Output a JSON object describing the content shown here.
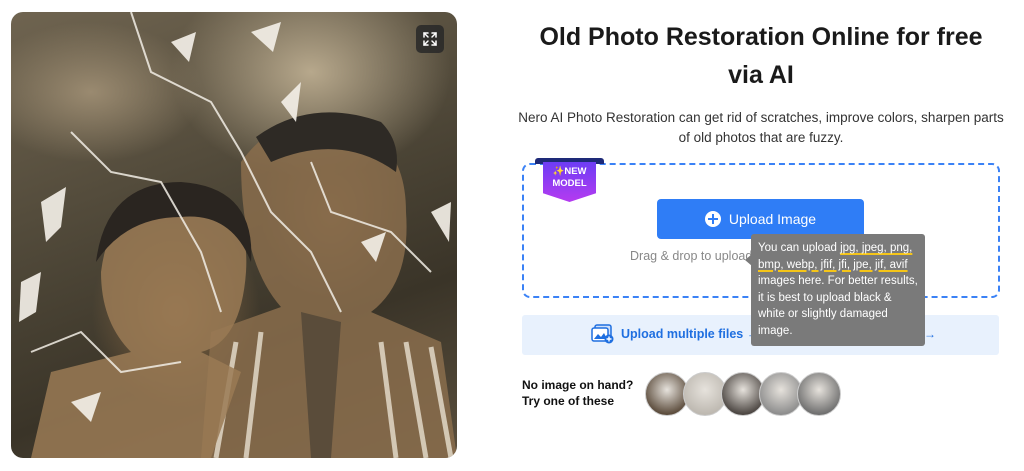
{
  "photo": {
    "alt": "Damaged sepia photo of a man and a woman",
    "expand_icon": "expand-icon"
  },
  "header": {
    "title": "Old Photo Restoration Online for free via AI",
    "description": "Nero AI Photo Restoration can get rid of scratches, improve colors, sharpen parts of old photos that are fuzzy."
  },
  "badge": {
    "line1": "NEW",
    "line2": "MODEL",
    "icon": "sparkle-icon",
    "colors": {
      "top": "#6d3df5",
      "bottom": "#b53bf0",
      "ribbon": "#1e2a78"
    }
  },
  "upload": {
    "button_label": "Upload Image",
    "button_icon": "plus-circle-icon",
    "drag_text": "Drag & drop to upload",
    "accent": "#2f7df6"
  },
  "multi": {
    "label": "Upload multiple files →",
    "trailing_arrow": "→",
    "icon": "multiple-files-icon"
  },
  "tooltip": {
    "lines": [
      {
        "prefix": "You can upload ",
        "underlined": "jpg, jpeg, png,"
      },
      {
        "prefix": "",
        "underlined": "bmp, webp, jfif, jfi, jpe, jif, avif"
      },
      {
        "prefix": "images here. For better results,",
        "underlined": ""
      },
      {
        "prefix": "it is best to upload black &",
        "underlined": ""
      },
      {
        "prefix": "white or slightly damaged",
        "underlined": ""
      },
      {
        "prefix": "image.",
        "underlined": ""
      }
    ]
  },
  "samples": {
    "line1": "No image on hand?",
    "line2": "Try one of these",
    "thumbnails": [
      {
        "name": "sample-1",
        "tone": "#5a4a3a"
      },
      {
        "name": "sample-2",
        "tone": "#bdb8b0"
      },
      {
        "name": "sample-3",
        "tone": "#4a4440"
      },
      {
        "name": "sample-4",
        "tone": "#8c8c8c"
      },
      {
        "name": "sample-5",
        "tone": "#6e6e6e"
      }
    ]
  }
}
